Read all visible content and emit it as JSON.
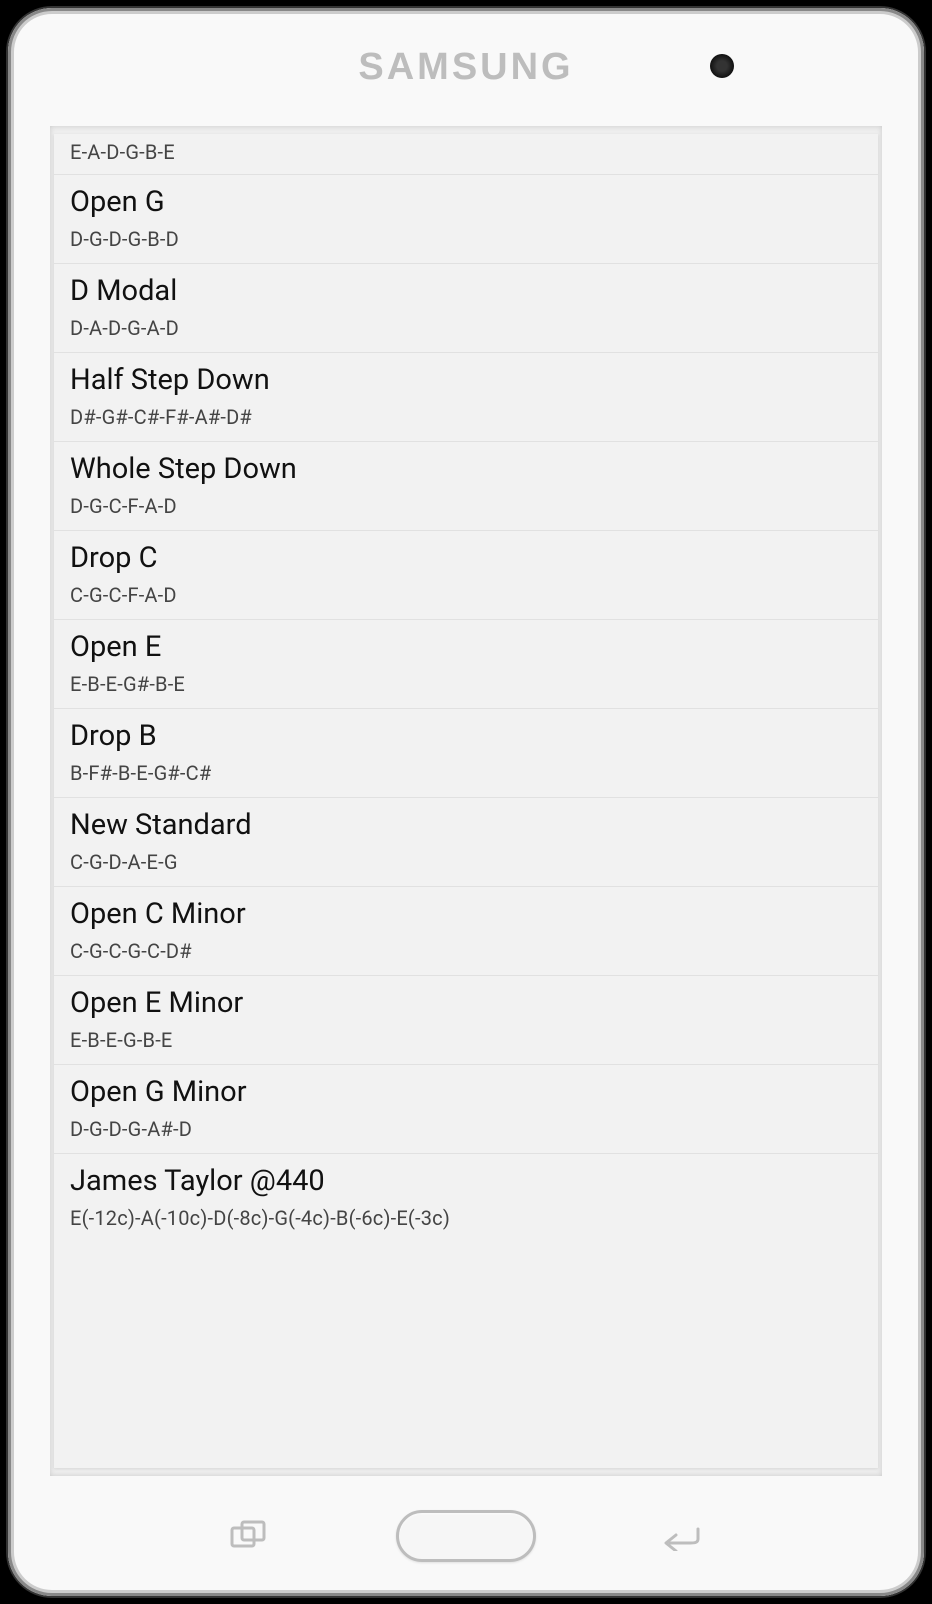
{
  "brand": "SAMSUNG",
  "partial_item": {
    "subtitle": "E-A-D-G-B-E"
  },
  "tunings": [
    {
      "title": "Open G",
      "subtitle": "D-G-D-G-B-D"
    },
    {
      "title": "D Modal",
      "subtitle": "D-A-D-G-A-D"
    },
    {
      "title": "Half Step Down",
      "subtitle": "D#-G#-C#-F#-A#-D#"
    },
    {
      "title": "Whole Step Down",
      "subtitle": "D-G-C-F-A-D"
    },
    {
      "title": "Drop C",
      "subtitle": "C-G-C-F-A-D"
    },
    {
      "title": "Open E",
      "subtitle": "E-B-E-G#-B-E"
    },
    {
      "title": "Drop B",
      "subtitle": "B-F#-B-E-G#-C#"
    },
    {
      "title": "New Standard",
      "subtitle": "C-G-D-A-E-G"
    },
    {
      "title": "Open C Minor",
      "subtitle": "C-G-C-G-C-D#"
    },
    {
      "title": "Open E Minor",
      "subtitle": "E-B-E-G-B-E"
    },
    {
      "title": "Open G Minor",
      "subtitle": "D-G-D-G-A#-D"
    },
    {
      "title": "James Taylor @440",
      "subtitle": "E(-12c)-A(-10c)-D(-8c)-G(-4c)-B(-6c)-E(-3c)"
    }
  ]
}
